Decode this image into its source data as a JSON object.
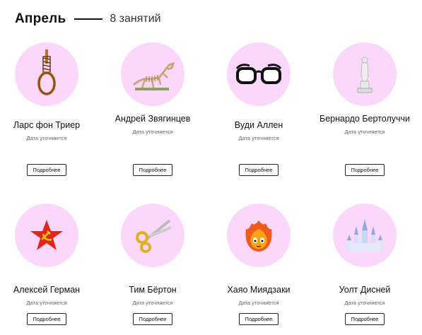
{
  "header": {
    "month": "Апрель",
    "count": "8 занятий"
  },
  "cards": [
    {
      "name": "Ларс фон Триер",
      "date": "Дата уточняется",
      "button": "Подробнее",
      "icon": "noose-icon"
    },
    {
      "name": "Андрей Звягинцев",
      "date": "Дата уточняется",
      "button": "Подробнее",
      "icon": "dinosaur-skeleton-icon"
    },
    {
      "name": "Вуди Аллен",
      "date": "Дата уточняется",
      "button": "Подробнее",
      "icon": "glasses-icon"
    },
    {
      "name": "Бернардо Бертолуччи",
      "date": "Дата уточняется",
      "button": "Подробнее",
      "icon": "statue-icon"
    },
    {
      "name": "Алексей Герман",
      "date": "Дата уточняется",
      "button": "Подробнее",
      "icon": "star-hammer-sickle-icon"
    },
    {
      "name": "Тим Бёртон",
      "date": "Дата уточняется",
      "button": "Подробнее",
      "icon": "scissors-icon"
    },
    {
      "name": "Хаяо Миядзаки",
      "date": "Дата уточняется",
      "button": "Подробнее",
      "icon": "fire-spirit-icon"
    },
    {
      "name": "Уолт Дисней",
      "date": "Дата уточняется",
      "button": "Подробнее",
      "icon": "castle-icon"
    }
  ],
  "colors": {
    "circle": "#fbd8fb",
    "star": "#e0261d"
  }
}
